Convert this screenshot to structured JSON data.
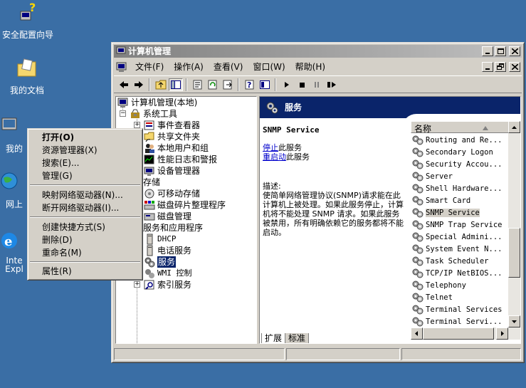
{
  "desktop": {
    "icons": [
      {
        "name": "安全配置向导"
      },
      {
        "name": "我的文档"
      },
      {
        "name": "我的"
      },
      {
        "name": "网上"
      },
      {
        "name": "Inte"
      },
      {
        "name": "Expl"
      }
    ]
  },
  "window": {
    "title": "计算机管理",
    "menu": [
      "文件(F)",
      "操作(A)",
      "查看(V)",
      "窗口(W)",
      "帮助(H)"
    ]
  },
  "tree": {
    "root": "计算机管理(本地)",
    "system_tools": "系统工具",
    "event_viewer": "事件查看器",
    "shared_folders": "共享文件夹",
    "local_users": "本地用户和组",
    "perf_logs": "性能日志和警报",
    "device_manager": "设备管理器",
    "storage": "存储",
    "removable": "可移动存储",
    "defrag": "磁盘碎片整理程序",
    "disk_mgmt": "磁盘管理",
    "services_apps": "服务和应用程序",
    "dhcp": "DHCP",
    "telephony": "电话服务",
    "services": "服务",
    "wmi": "WMI 控制",
    "index": "索引服务"
  },
  "right_pane": {
    "header": "服务",
    "service_title": "SNMP Service",
    "stop_link": "停止",
    "stop_suffix": "此服务",
    "restart_link": "重启动",
    "restart_suffix": "此服务",
    "desc_label": "描述:",
    "description": "使简单网络管理协议(SNMP)请求能在此计算机上被处理。如果此服务停止，计算机将不能处理 SNMP 请求。如果此服务被禁用，所有明确依赖它的服务都将不能启动。",
    "column_name": "名称",
    "services_list": [
      "Routing and Re...",
      "Secondary Logon",
      "Security Accou...",
      "Server",
      "Shell Hardware...",
      "Smart Card",
      "SNMP Service",
      "SNMP Trap Service",
      "Special Admini...",
      "System Event N...",
      "Task Scheduler",
      "TCP/IP NetBIOS...",
      "Telephony",
      "Telnet",
      "Terminal Services",
      "Terminal Servi..."
    ],
    "selected_service": "SNMP Service",
    "tabs": [
      "扩展",
      "标准"
    ]
  },
  "context_menu": {
    "items": [
      "打开(O)",
      "资源管理器(X)",
      "搜索(E)...",
      "管理(G)",
      "映射网络驱动器(N)...",
      "断开网络驱动器(I)...",
      "创建快捷方式(S)",
      "删除(D)",
      "重命名(M)",
      "属性(R)"
    ]
  }
}
